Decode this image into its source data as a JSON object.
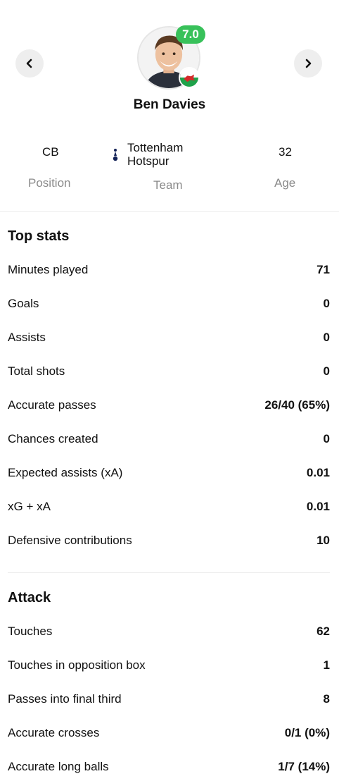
{
  "player": {
    "name": "Ben Davies",
    "rating": "7.0",
    "rating_color": "#38c15a"
  },
  "info": {
    "position": {
      "value": "CB",
      "label": "Position"
    },
    "team": {
      "value_line1": "Tottenham",
      "value_line2": "Hotspur",
      "label": "Team"
    },
    "age": {
      "value": "32",
      "label": "Age"
    }
  },
  "top_stats": {
    "title": "Top stats",
    "rows": [
      {
        "label": "Minutes played",
        "value": "71"
      },
      {
        "label": "Goals",
        "value": "0"
      },
      {
        "label": "Assists",
        "value": "0"
      },
      {
        "label": "Total shots",
        "value": "0"
      },
      {
        "label": "Accurate passes",
        "value": "26/40 (65%)"
      },
      {
        "label": "Chances created",
        "value": "0"
      },
      {
        "label": "Expected assists (xA)",
        "value": "0.01"
      },
      {
        "label": "xG + xA",
        "value": "0.01"
      },
      {
        "label": "Defensive contributions",
        "value": "10"
      }
    ]
  },
  "attack": {
    "title": "Attack",
    "rows": [
      {
        "label": "Touches",
        "value": "62"
      },
      {
        "label": "Touches in opposition box",
        "value": "1"
      },
      {
        "label": "Passes into final third",
        "value": "8"
      },
      {
        "label": "Accurate crosses",
        "value": "0/1 (0%)"
      },
      {
        "label": "Accurate long balls",
        "value": "1/7 (14%)"
      }
    ]
  },
  "icons": {
    "prev": "chevron-left-icon",
    "next": "chevron-right-icon",
    "flag": "wales-flag-icon",
    "team_logo": "tottenham-crest-icon"
  }
}
